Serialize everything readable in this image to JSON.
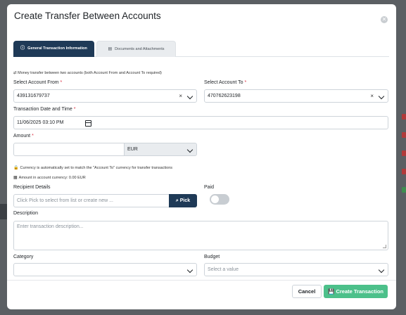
{
  "modal": {
    "title": "Create Transfer Between Accounts",
    "close_icon": "close-icon"
  },
  "tabs": [
    {
      "label": "General Transaction Information",
      "icon": "info-icon",
      "active": true
    },
    {
      "label": "Documents and Attachments",
      "icon": "document-icon",
      "active": false
    }
  ],
  "transfer_note": "⇄ Money transfer between two accounts (both Account From and Account To required)",
  "account_from": {
    "label": "Select Account From",
    "required": "*",
    "value": "439131679737"
  },
  "account_to": {
    "label": "Select Account To",
    "required": "*",
    "value": "470762623198"
  },
  "date": {
    "label": "Transaction Date and Time",
    "required": "*",
    "value": "11/06/2025 03:10 PM"
  },
  "amount": {
    "label": "Amount",
    "required": "*",
    "value": "",
    "currency": "EUR"
  },
  "currency_note": "Currency is automatically set to match the \"Account To\" currency for transfer transactions",
  "balance_note": "Amount in account currency: 0.00 EUR",
  "recipient": {
    "label": "Recipient Details",
    "placeholder": "Click Pick to select from list or create new ...",
    "pick_label": "Pick"
  },
  "paid": {
    "label": "Paid",
    "on": false
  },
  "description": {
    "label": "Description",
    "placeholder": "Enter transaction description..."
  },
  "category": {
    "label": "Category",
    "value": ""
  },
  "budget": {
    "label": "Budget",
    "placeholder": "Select a value"
  },
  "footer": {
    "cancel_label": "Cancel",
    "create_label": "Create Transaction"
  },
  "colors": {
    "primary": "#1f3a57",
    "success": "#4cc08a",
    "required": "#dc3545"
  }
}
